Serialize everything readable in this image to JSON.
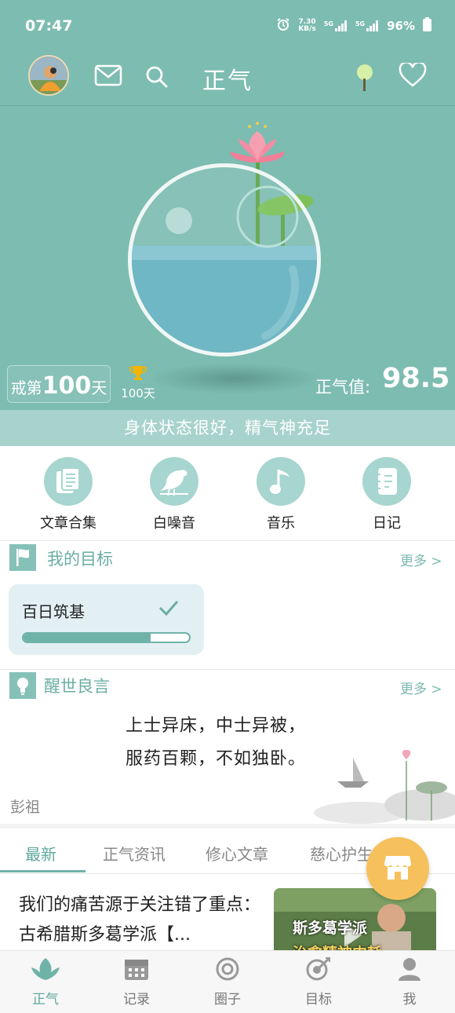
{
  "status_bar": {
    "time": "07:47",
    "net_speed_value": "7.30",
    "net_speed_unit": "KB/s",
    "signal1": "5G",
    "signal2": "5G",
    "battery": "96%"
  },
  "header": {
    "title": "正气"
  },
  "hero": {
    "days_prefix": "戒第",
    "days_value": "100",
    "days_suffix": "天",
    "trophy_label": "100天",
    "zhengqi_label": "正气值:",
    "zhengqi_value": "98.5",
    "status_text": "身体状态很好，精气神充足"
  },
  "quick_actions": [
    {
      "label": "文章合集",
      "icon": "document-icon"
    },
    {
      "label": "白噪音",
      "icon": "bird-icon"
    },
    {
      "label": "音乐",
      "icon": "music-note-icon"
    },
    {
      "label": "日记",
      "icon": "diary-icon"
    }
  ],
  "goals": {
    "title": "我的目标",
    "more": "更多 >",
    "card": {
      "name": "百日筑基",
      "progress": 0.77
    }
  },
  "quotes": {
    "title": "醒世良言",
    "more": "更多 >",
    "line1": "上士异床，中士异被，",
    "line2": "服药百颗，不如独卧。",
    "author": "彭祖"
  },
  "tabs": [
    "最新",
    "正气资讯",
    "修心文章",
    "慈心护生"
  ],
  "news": {
    "title": "我们的痛苦源于关注错了重点：古希腊斯多葛学派【...",
    "thumb_text1": "斯多葛学派",
    "thumb_text2": "治愈精神内耗"
  },
  "bottom_nav": [
    "正气",
    "记录",
    "圈子",
    "目标",
    "我"
  ],
  "colors": {
    "theme": "#7dbcb1",
    "accent": "#6fb3a8",
    "fab": "#f6c15c"
  }
}
